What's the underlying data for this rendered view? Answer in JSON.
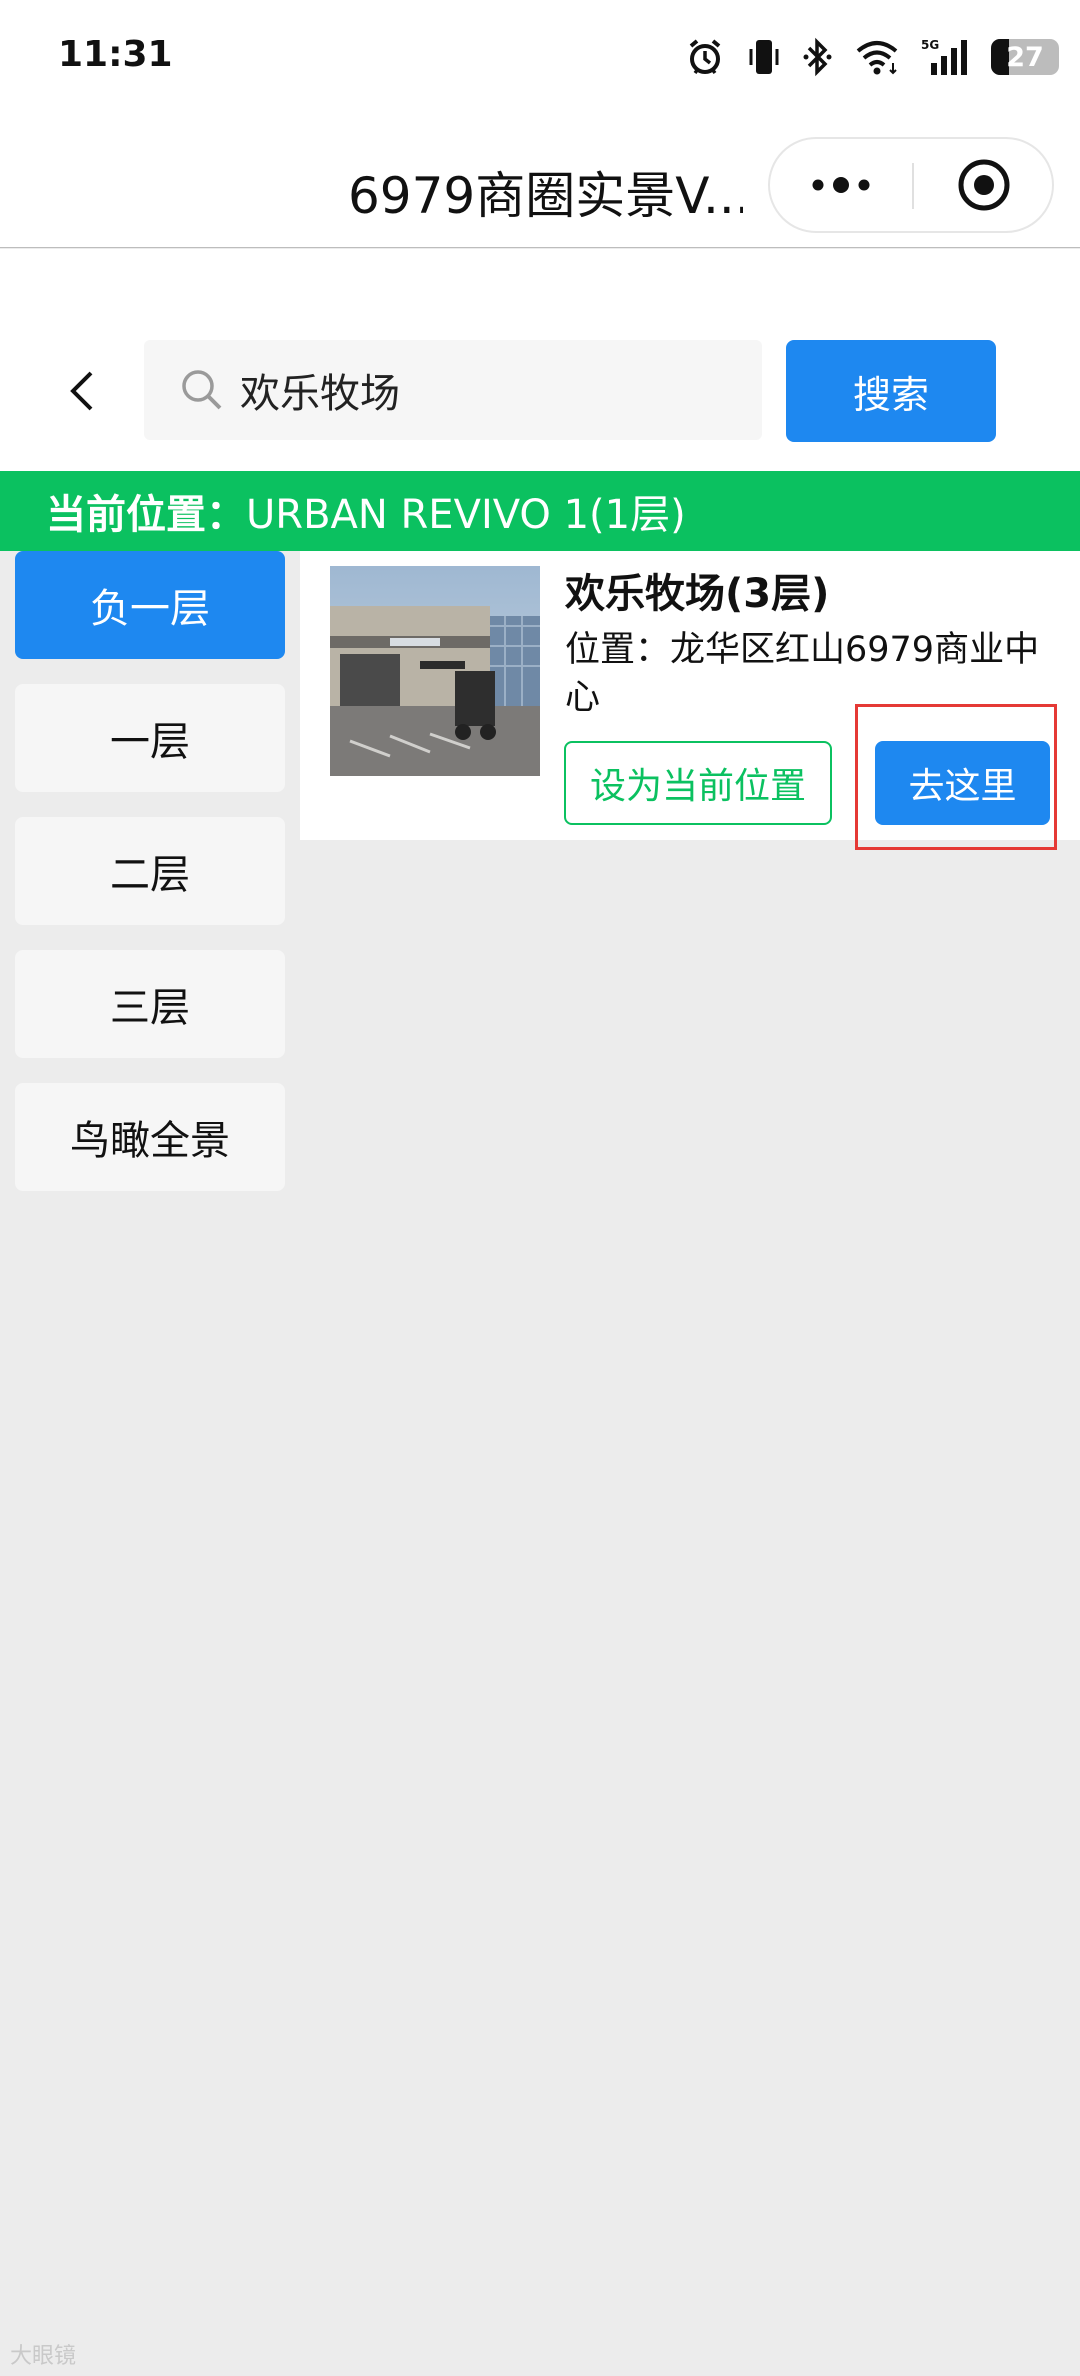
{
  "status_bar": {
    "time": "11:31",
    "battery": "27",
    "network": "5G",
    "icons": [
      "alarm-icon",
      "vibrate-icon",
      "bluetooth-icon",
      "wifi-icon",
      "signal-icon",
      "battery-icon"
    ]
  },
  "title_bar": {
    "title": "6979商圈实景V...",
    "capsule_icons": [
      "more-dots-icon",
      "close-target-icon"
    ]
  },
  "search": {
    "query": "欢乐牧场",
    "button_label": "搜索"
  },
  "location": {
    "label": "当前位置：",
    "value": "URBAN REVIVO 1(1层)"
  },
  "floors": [
    {
      "label": "负一层",
      "active": true
    },
    {
      "label": "一层",
      "active": false
    },
    {
      "label": "二层",
      "active": false
    },
    {
      "label": "三层",
      "active": false
    },
    {
      "label": "鸟瞰全景",
      "active": false
    }
  ],
  "results": [
    {
      "name": "欢乐牧场(3层)",
      "location": "位置：龙华区红山6979商业中心",
      "set_label": "设为当前位置",
      "go_label": "去这里"
    }
  ],
  "watermark": "大眼镜",
  "colors": {
    "primary_blue": "#1e88f0",
    "green": "#0bc160",
    "highlight_red": "#e53935",
    "background": "#ececec"
  }
}
